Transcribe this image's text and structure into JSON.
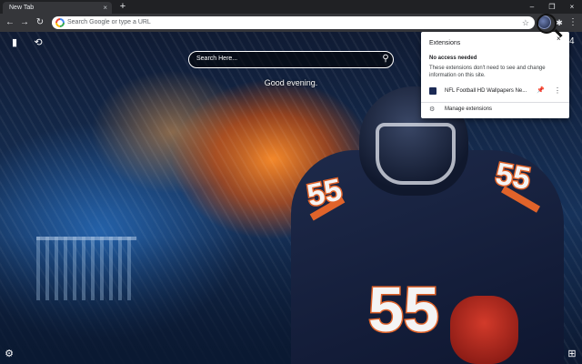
{
  "browser": {
    "tab_title": "New Tab",
    "tab_close": "×",
    "new_tab": "+",
    "minimize": "–",
    "restore": "❐",
    "close": "×"
  },
  "toolbar": {
    "back": "←",
    "forward": "→",
    "reload": "↻",
    "omnibox_placeholder": "Search Google or type a URL",
    "bookmark_star": "☆",
    "extensions_icon": "✱",
    "menu": "⋮"
  },
  "newtab": {
    "search_placeholder": "Search Here...",
    "search_button": "⚲",
    "greeting": "Good evening.",
    "bookmark_icon": "▮",
    "history_icon": "⟲",
    "settings_icon": "⚙",
    "apps_icon": "⊞",
    "jersey_number": "55"
  },
  "extensions_popup": {
    "title": "Extensions",
    "close": "×",
    "section_title": "No access needed",
    "section_desc": "These extensions don't need to see and change information on this site.",
    "items": [
      {
        "label": "NFL Football HD Wallpapers Ne...",
        "pin": "📌",
        "more": "⋮"
      }
    ],
    "manage_icon": "⚙",
    "manage_label": "Manage extensions"
  },
  "peek": {
    "partial_text": "4"
  },
  "colors": {
    "accent": "#1a73e8",
    "titlebar": "#202124",
    "toolbar": "#35363a",
    "bears_orange": "#e0632a",
    "bears_navy": "#0e1630"
  }
}
